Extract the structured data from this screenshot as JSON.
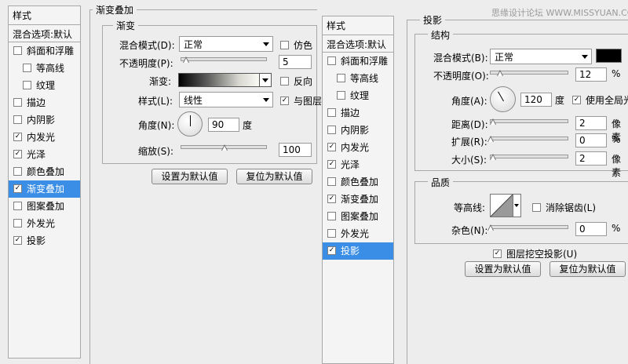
{
  "left_panel": {
    "header": "样式",
    "blend_options": "混合选项:默认",
    "items": [
      {
        "label": "斜面和浮雕",
        "checked": false,
        "sub": false,
        "selected": false
      },
      {
        "label": "等高线",
        "checked": false,
        "sub": true,
        "selected": false
      },
      {
        "label": "纹理",
        "checked": false,
        "sub": true,
        "selected": false
      },
      {
        "label": "描边",
        "checked": false,
        "sub": false,
        "selected": false
      },
      {
        "label": "内阴影",
        "checked": false,
        "sub": false,
        "selected": false
      },
      {
        "label": "内发光",
        "checked": true,
        "sub": false,
        "selected": false
      },
      {
        "label": "光泽",
        "checked": true,
        "sub": false,
        "selected": false
      },
      {
        "label": "颜色叠加",
        "checked": false,
        "sub": false,
        "selected": false
      },
      {
        "label": "渐变叠加",
        "checked": true,
        "sub": false,
        "selected": true
      },
      {
        "label": "图案叠加",
        "checked": false,
        "sub": false,
        "selected": false
      },
      {
        "label": "外发光",
        "checked": false,
        "sub": false,
        "selected": false
      },
      {
        "label": "投影",
        "checked": true,
        "sub": false,
        "selected": false
      }
    ]
  },
  "gradient_overlay": {
    "title": "渐变叠加",
    "group": "渐变",
    "blend_mode_label": "混合模式(D):",
    "blend_mode_value": "正常",
    "dither_label": "仿色",
    "opacity_label": "不透明度(P):",
    "opacity_value": "5",
    "opacity_pct": 0.05,
    "gradient_label": "渐变:",
    "reverse_label": "反向",
    "style_label": "样式(L):",
    "style_value": "线性",
    "align_label": "与图层",
    "angle_label": "角度(N):",
    "angle_value": "90",
    "angle_unit": "度",
    "scale_label": "缩放(S):",
    "scale_value": "100",
    "scale_pct": 0.5,
    "default_btn": "设置为默认值",
    "reset_btn": "复位为默认值"
  },
  "right_panel": {
    "header": "样式",
    "blend_options": "混合选项:默认",
    "items": [
      {
        "label": "斜面和浮雕",
        "checked": false,
        "sub": false,
        "selected": false
      },
      {
        "label": "等高线",
        "checked": false,
        "sub": true,
        "selected": false
      },
      {
        "label": "纹理",
        "checked": false,
        "sub": true,
        "selected": false
      },
      {
        "label": "描边",
        "checked": false,
        "sub": false,
        "selected": false
      },
      {
        "label": "内阴影",
        "checked": false,
        "sub": false,
        "selected": false
      },
      {
        "label": "内发光",
        "checked": true,
        "sub": false,
        "selected": false
      },
      {
        "label": "光泽",
        "checked": true,
        "sub": false,
        "selected": false
      },
      {
        "label": "颜色叠加",
        "checked": false,
        "sub": false,
        "selected": false
      },
      {
        "label": "渐变叠加",
        "checked": true,
        "sub": false,
        "selected": false
      },
      {
        "label": "图案叠加",
        "checked": false,
        "sub": false,
        "selected": false
      },
      {
        "label": "外发光",
        "checked": false,
        "sub": false,
        "selected": false
      },
      {
        "label": "投影",
        "checked": true,
        "sub": false,
        "selected": true
      }
    ]
  },
  "drop_shadow": {
    "title": "投影",
    "watermark": "思缘设计论坛 WWW.MISSYUAN.COM",
    "structure": "结构",
    "blend_mode_label": "混合模式(B):",
    "blend_mode_value": "正常",
    "shadow_color": "#000000",
    "opacity_label": "不透明度(O):",
    "opacity_value": "12",
    "opacity_pct": 0.12,
    "percent": "%",
    "angle_label": "角度(A):",
    "angle_value": "120",
    "angle_unit": "度",
    "global_light_label": "使用全局光",
    "distance_label": "距离(D):",
    "distance_value": "2",
    "px_unit": "像素",
    "spread_label": "扩展(R):",
    "spread_value": "0",
    "size_label": "大小(S):",
    "size_value": "2",
    "quality": "品质",
    "contour_label": "等高线:",
    "antialias_label": "消除锯齿(L)",
    "noise_label": "杂色(N):",
    "noise_value": "0",
    "knockout_label": "图层挖空投影(U)",
    "default_btn": "设置为默认值",
    "reset_btn": "复位为默认值"
  },
  "colors": {
    "selected": "#3b8ee5",
    "background": "#ededed"
  }
}
